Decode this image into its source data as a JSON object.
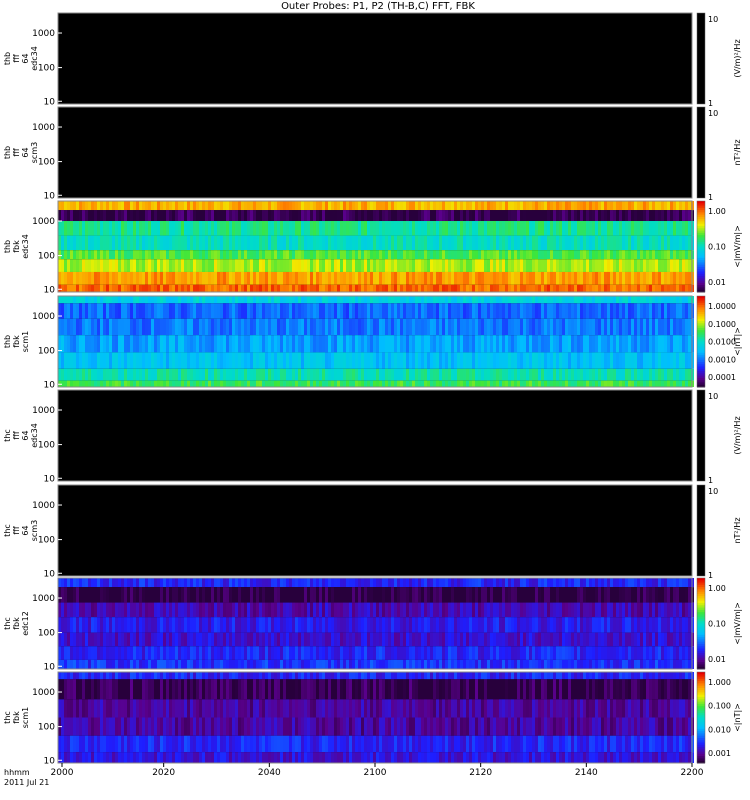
{
  "title": "Outer Probes: P1, P2 (TH-B,C) FFT, FBK",
  "chart_data": {
    "type": "heatmap",
    "title": "Outer Probes: P1, P2 (TH-B,C) FFT, FBK",
    "x_axis": {
      "label_line1": "hhmm",
      "label_line2": "2011 Jul 21",
      "ticks": [
        "2000",
        "2020",
        "2040",
        "2100",
        "2120",
        "2140",
        "2200"
      ],
      "range": [
        "2000",
        "2200"
      ]
    },
    "panels": [
      {
        "id": "thb-fff-edc34",
        "ylabel": [
          "thb",
          "fff",
          "64",
          "edc34"
        ],
        "y_scale": "log",
        "y_ticks": [
          "1000",
          "100",
          "10"
        ],
        "colorbar": {
          "label": "(V/m)²/Hz",
          "ticks": [
            "10",
            "1"
          ],
          "style": "gray"
        },
        "data": "empty",
        "bands": []
      },
      {
        "id": "thb-fff-scm3",
        "ylabel": [
          "thb",
          "fff",
          "64",
          "scm3"
        ],
        "y_scale": "log",
        "y_ticks": [
          "1000",
          "100",
          "10"
        ],
        "colorbar": {
          "label": "nT²/Hz",
          "ticks": [
            "10",
            "1"
          ],
          "style": "gray"
        },
        "data": "empty",
        "bands": []
      },
      {
        "id": "thb-fbk-edc34",
        "ylabel": [
          "thb",
          "fbk",
          "edc34"
        ],
        "y_scale": "log",
        "y_ticks": [
          "1000",
          "100",
          "10"
        ],
        "colorbar": {
          "label": "<|mV/m|>",
          "ticks": [
            "1.00",
            "0.10",
            "0.01"
          ],
          "style": "rainbow"
        },
        "data": "present",
        "bands": [
          {
            "from": 1,
            "to": 0.9,
            "level": 0.82
          },
          {
            "from": 0.9,
            "to": 0.78,
            "level": 0.02
          },
          {
            "from": 0.78,
            "to": 0.62,
            "level": 0.55
          },
          {
            "from": 0.62,
            "to": 0.46,
            "level": 0.5
          },
          {
            "from": 0.46,
            "to": 0.36,
            "level": 0.62
          },
          {
            "from": 0.36,
            "to": 0.22,
            "level": 0.7
          },
          {
            "from": 0.22,
            "to": 0.08,
            "level": 0.84
          },
          {
            "from": 0.08,
            "to": 0,
            "level": 0.9
          }
        ]
      },
      {
        "id": "thb-fbk-scm1",
        "ylabel": [
          "thb",
          "fbk",
          "scm1"
        ],
        "y_scale": "log",
        "y_ticks": [
          "1000",
          "100",
          "10"
        ],
        "colorbar": {
          "label": "<|nT|>",
          "ticks": [
            "1.0000",
            "0.1000",
            "0.0100",
            "0.0010",
            "0.0001"
          ],
          "style": "rainbow"
        },
        "data": "present",
        "bands": [
          {
            "from": 1,
            "to": 0.92,
            "level": 0.45
          },
          {
            "from": 0.92,
            "to": 0.75,
            "level": 0.28
          },
          {
            "from": 0.75,
            "to": 0.57,
            "level": 0.3
          },
          {
            "from": 0.57,
            "to": 0.38,
            "level": 0.35
          },
          {
            "from": 0.38,
            "to": 0.2,
            "level": 0.4
          },
          {
            "from": 0.2,
            "to": 0.07,
            "level": 0.52
          },
          {
            "from": 0.07,
            "to": 0,
            "level": 0.6
          }
        ]
      },
      {
        "id": "thc-fff-edc34",
        "ylabel": [
          "thc",
          "fff",
          "64",
          "edc34"
        ],
        "y_scale": "log",
        "y_ticks": [
          "1000",
          "100",
          "10"
        ],
        "colorbar": {
          "label": "(V/m)²/Hz",
          "ticks": [
            "10",
            "1"
          ],
          "style": "gray"
        },
        "data": "empty",
        "bands": []
      },
      {
        "id": "thc-fff-scm3",
        "ylabel": [
          "thc",
          "fff",
          "64",
          "scm3"
        ],
        "y_scale": "log",
        "y_ticks": [
          "1000",
          "100",
          "10"
        ],
        "colorbar": {
          "label": "nT²/Hz",
          "ticks": [
            "10",
            "1"
          ],
          "style": "gray"
        },
        "data": "empty",
        "bands": []
      },
      {
        "id": "thc-fbk-edc12",
        "ylabel": [
          "thc",
          "fbk",
          "edc12"
        ],
        "y_scale": "log",
        "y_ticks": [
          "1000",
          "100",
          "10"
        ],
        "colorbar": {
          "label": "<|mV/m|>",
          "ticks": [
            "1.00",
            "0.10",
            "0.01"
          ],
          "style": "rainbow"
        },
        "data": "present",
        "bands": [
          {
            "from": 1,
            "to": 0.9,
            "level": 0.2
          },
          {
            "from": 0.9,
            "to": 0.73,
            "level": 0.0
          },
          {
            "from": 0.73,
            "to": 0.57,
            "level": 0.12
          },
          {
            "from": 0.57,
            "to": 0.4,
            "level": 0.18
          },
          {
            "from": 0.4,
            "to": 0.25,
            "level": 0.15
          },
          {
            "from": 0.25,
            "to": 0.1,
            "level": 0.2
          },
          {
            "from": 0.1,
            "to": 0,
            "level": 0.22
          }
        ]
      },
      {
        "id": "thc-fbk-scm1",
        "ylabel": [
          "thc",
          "fbk",
          "scm1"
        ],
        "y_scale": "log",
        "y_ticks": [
          "1000",
          "100",
          "10"
        ],
        "colorbar": {
          "label": "<|nT|>",
          "ticks": [
            "1.000",
            "0.100",
            "0.010",
            "0.001"
          ],
          "style": "rainbow"
        },
        "data": "present",
        "bands": [
          {
            "from": 1,
            "to": 0.92,
            "level": 0.2
          },
          {
            "from": 0.92,
            "to": 0.7,
            "level": 0.02
          },
          {
            "from": 0.7,
            "to": 0.5,
            "level": 0.1
          },
          {
            "from": 0.5,
            "to": 0.3,
            "level": 0.1
          },
          {
            "from": 0.3,
            "to": 0.12,
            "level": 0.2
          },
          {
            "from": 0.12,
            "to": 0,
            "level": 0.16
          }
        ]
      }
    ]
  }
}
